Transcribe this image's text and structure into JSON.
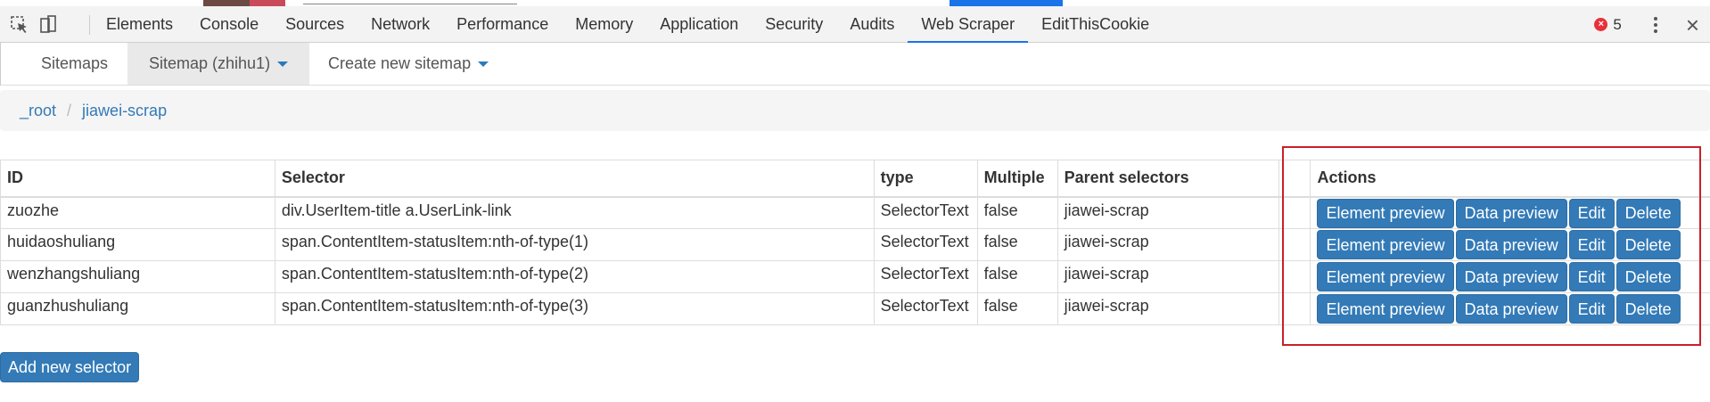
{
  "devtools": {
    "tabs": [
      "Elements",
      "Console",
      "Sources",
      "Network",
      "Performance",
      "Memory",
      "Application",
      "Security",
      "Audits",
      "Web Scraper",
      "EditThisCookie"
    ],
    "active_tab": "Web Scraper",
    "error_count": "5"
  },
  "scraper_nav": {
    "sitemaps": "Sitemaps",
    "current_sitemap": "Sitemap (zhihu1)",
    "create_new": "Create new sitemap"
  },
  "breadcrumb": {
    "root": "_root",
    "current": "jiawei-scrap"
  },
  "table": {
    "headers": {
      "id": "ID",
      "selector": "Selector",
      "type": "type",
      "multiple": "Multiple",
      "parent": "Parent selectors",
      "actions": "Actions"
    },
    "rows": [
      {
        "id": "zuozhe",
        "selector": "div.UserItem-title a.UserLink-link",
        "type": "SelectorText",
        "multiple": "false",
        "parent": "jiawei-scrap"
      },
      {
        "id": "huidaoshuliang",
        "selector": "span.ContentItem-statusItem:nth-of-type(1)",
        "type": "SelectorText",
        "multiple": "false",
        "parent": "jiawei-scrap"
      },
      {
        "id": "wenzhangshuliang",
        "selector": "span.ContentItem-statusItem:nth-of-type(2)",
        "type": "SelectorText",
        "multiple": "false",
        "parent": "jiawei-scrap"
      },
      {
        "id": "guanzhushuliang",
        "selector": "span.ContentItem-statusItem:nth-of-type(3)",
        "type": "SelectorText",
        "multiple": "false",
        "parent": "jiawei-scrap"
      }
    ],
    "actions": {
      "element_preview": "Element preview",
      "data_preview": "Data preview",
      "edit": "Edit",
      "delete": "Delete"
    }
  },
  "add_selector": "Add new selector",
  "colors": {
    "accent": "#1a73e8",
    "button": "#337ab7",
    "highlight_box": "#c8202a",
    "error": "#e8303a"
  }
}
